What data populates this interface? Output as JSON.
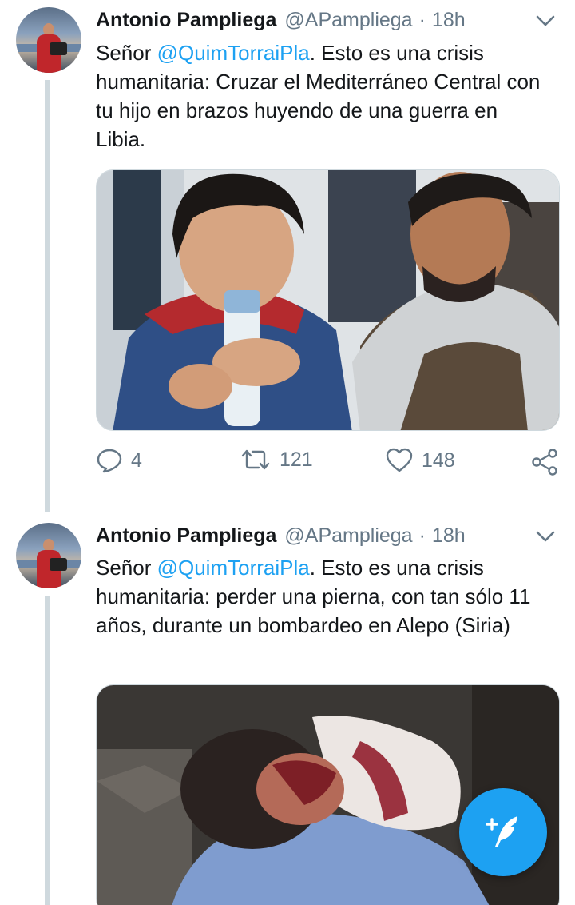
{
  "tweets": [
    {
      "author_name": "Antonio Pampliega",
      "author_handle": "@APampliega",
      "separator": "·",
      "time": "18h",
      "text_prefix": "Señor ",
      "mention": "@QuimTorraiPla",
      "text_body": ". Esto es una crisis humanitaria: Cruzar el Mediterráneo Central con tu hijo en brazos huyendo de una guerra en Libia.",
      "media_icon": "photo-refugee-father-child",
      "replies": "4",
      "retweets": "121",
      "likes": "148"
    },
    {
      "author_name": "Antonio Pampliega",
      "author_handle": "@APampliega",
      "separator": "·",
      "time": "18h",
      "text_prefix": "Señor ",
      "mention": "@QuimTorraiPla",
      "text_body": ". Esto es una crisis humanitaria: perder una pierna, con tan sólo 11 años, durante un bombardeo en Alepo (Siria)",
      "media_icon": "photo-injured-child"
    }
  ],
  "colors": {
    "accent": "#1da1f2",
    "secondary_text": "#657786",
    "thread_line": "#cfd9de"
  },
  "fab": {
    "icon": "compose-tweet-icon"
  }
}
